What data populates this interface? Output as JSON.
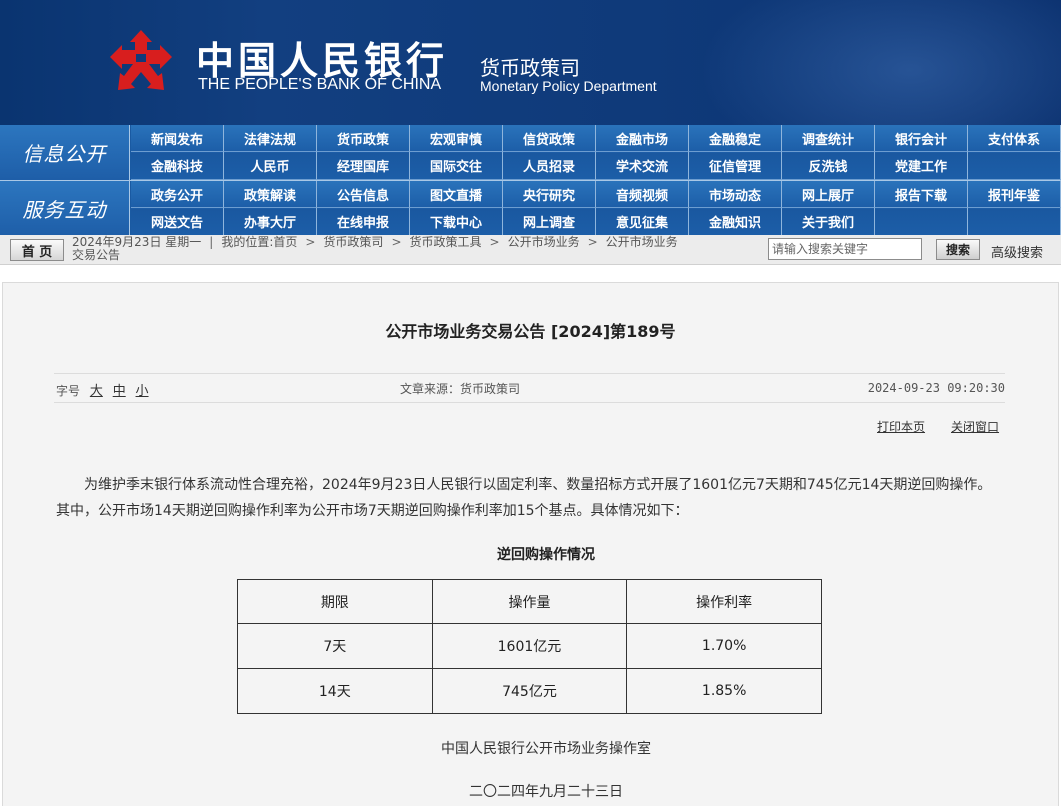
{
  "header": {
    "bank_name_cn": "中国人民银行",
    "bank_name_en": "THE PEOPLE'S BANK OF CHINA",
    "dept_cn": "货币政策司",
    "dept_en": "Monetary Policy Department",
    "colors": {
      "banner": "#0f3a7a",
      "logo_red": "#d81e1e",
      "nav": "#1c5da7"
    }
  },
  "nav": {
    "block1": {
      "label": "信息公开",
      "items": [
        "新闻发布",
        "法律法规",
        "货币政策",
        "宏观审慎",
        "信贷政策",
        "金融市场",
        "金融稳定",
        "调查统计",
        "银行会计",
        "支付体系",
        "金融科技",
        "人民币",
        "经理国库",
        "国际交往",
        "人员招录",
        "学术交流",
        "征信管理",
        "反洗钱",
        "党建工作",
        ""
      ]
    },
    "block2": {
      "label": "服务互动",
      "items": [
        "政务公开",
        "政策解读",
        "公告信息",
        "图文直播",
        "央行研究",
        "音频视频",
        "市场动态",
        "网上展厅",
        "报告下载",
        "报刊年鉴",
        "网送文告",
        "办事大厅",
        "在线申报",
        "下载中心",
        "网上调查",
        "意见征集",
        "金融知识",
        "关于我们",
        "",
        ""
      ]
    }
  },
  "crumbs": {
    "home": "首 页",
    "date": "2024年9月23日 星期一",
    "location_label": "我的位置:首页",
    "path": [
      "货币政策司",
      "货币政策工具",
      "公开市场业务",
      "公开市场业务"
    ],
    "last": "交易公告",
    "search_placeholder": "请输入搜索关键字",
    "search_btn": "搜索",
    "advanced": "高级搜索"
  },
  "article": {
    "title": "公开市场业务交易公告 [2024]第189号",
    "font_label": "字号",
    "font_sizes": [
      "大",
      "中",
      "小"
    ],
    "source": "文章来源：货币政策司",
    "datetime": "2024-09-23 09:20:30",
    "print": "打印本页",
    "close": "关闭窗口",
    "body": "为维护季末银行体系流动性合理充裕，2024年9月23日人民银行以固定利率、数量招标方式开展了1601亿元7天期和745亿元14天期逆回购操作。其中，公开市场14天期逆回购操作利率为公开市场7天期逆回购操作利率加15个基点。具体情况如下：",
    "table_title": "逆回购操作情况",
    "table": {
      "headers": [
        "期限",
        "操作量",
        "操作利率"
      ],
      "rows": [
        [
          "7天",
          "1601亿元",
          "1.70%"
        ],
        [
          "14天",
          "745亿元",
          "1.85%"
        ]
      ]
    },
    "signature": "中国人民银行公开市场业务操作室",
    "date_cn": "二〇二四年九月二十三日"
  }
}
